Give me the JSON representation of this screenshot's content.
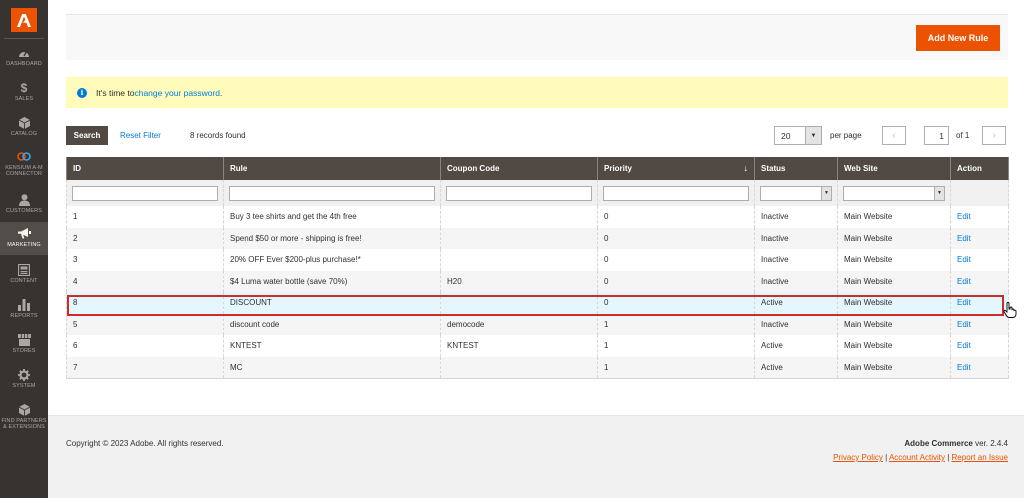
{
  "sidebar": {
    "logo": "adobe-logo",
    "items": [
      {
        "label": "DASHBOARD",
        "icon": "dashboard-icon"
      },
      {
        "label": "SALES",
        "icon": "dollar-icon"
      },
      {
        "label": "CATALOG",
        "icon": "cube-icon"
      },
      {
        "label": "KENSIUM A-M CONNECTOR",
        "icon": "connector-icon"
      },
      {
        "label": "CUSTOMERS",
        "icon": "person-icon"
      },
      {
        "label": "MARKETING",
        "icon": "megaphone-icon",
        "active": true
      },
      {
        "label": "CONTENT",
        "icon": "content-icon"
      },
      {
        "label": "REPORTS",
        "icon": "bar-chart-icon"
      },
      {
        "label": "STORES",
        "icon": "store-icon"
      },
      {
        "label": "SYSTEM",
        "icon": "gear-icon"
      },
      {
        "label": "FIND PARTNERS & EXTENSIONS",
        "icon": "extensions-icon"
      }
    ]
  },
  "page_actions": {
    "add_new_rule": "Add New Rule"
  },
  "message": {
    "prefix": "It's time to ",
    "link": "change your password",
    "suffix": "."
  },
  "toolbar": {
    "search": "Search",
    "reset_filter": "Reset Filter",
    "records_found": "8 records found",
    "per_page_value": "20",
    "per_page_label": "per page",
    "page_number": "1",
    "page_of": "of 1"
  },
  "grid": {
    "columns": [
      "ID",
      "Rule",
      "Coupon Code",
      "Priority",
      "Status",
      "Web Site",
      "Action"
    ],
    "sort_indicator": "↓",
    "rows": [
      {
        "id": "1",
        "rule": "Buy 3 tee shirts and get the 4th free",
        "coupon": "",
        "priority": "0",
        "status": "Inactive",
        "website": "Main Website",
        "action": "Edit"
      },
      {
        "id": "2",
        "rule": "Spend $50 or more - shipping is free!",
        "coupon": "",
        "priority": "0",
        "status": "Inactive",
        "website": "Main Website",
        "action": "Edit"
      },
      {
        "id": "3",
        "rule": "20% OFF Ever $200-plus purchase!*",
        "coupon": "",
        "priority": "0",
        "status": "Inactive",
        "website": "Main Website",
        "action": "Edit"
      },
      {
        "id": "4",
        "rule": "$4 Luma water bottle (save 70%)",
        "coupon": "H20",
        "priority": "0",
        "status": "Inactive",
        "website": "Main Website",
        "action": "Edit"
      },
      {
        "id": "8",
        "rule": "DISCOUNT",
        "coupon": "",
        "priority": "0",
        "status": "Active",
        "website": "Main Website",
        "action": "Edit"
      },
      {
        "id": "5",
        "rule": "discount code",
        "coupon": "democode",
        "priority": "1",
        "status": "Inactive",
        "website": "Main Website",
        "action": "Edit"
      },
      {
        "id": "6",
        "rule": "KNTEST",
        "coupon": "KNTEST",
        "priority": "1",
        "status": "Active",
        "website": "Main Website",
        "action": "Edit"
      },
      {
        "id": "7",
        "rule": "MC",
        "coupon": "",
        "priority": "1",
        "status": "Active",
        "website": "Main Website",
        "action": "Edit"
      }
    ]
  },
  "footer": {
    "copyright": "Copyright © 2023 Adobe. All rights reserved.",
    "product_name": "Adobe Commerce",
    "version": " ver. 2.4.4",
    "links": [
      "Privacy Policy",
      "Account Activity",
      "Report an Issue"
    ],
    "separator": " | "
  },
  "colors": {
    "accent": "#eb5202",
    "sidebar": "#373330",
    "header": "#514943",
    "link": "#007bdb",
    "highlight": "#d12a2a"
  }
}
